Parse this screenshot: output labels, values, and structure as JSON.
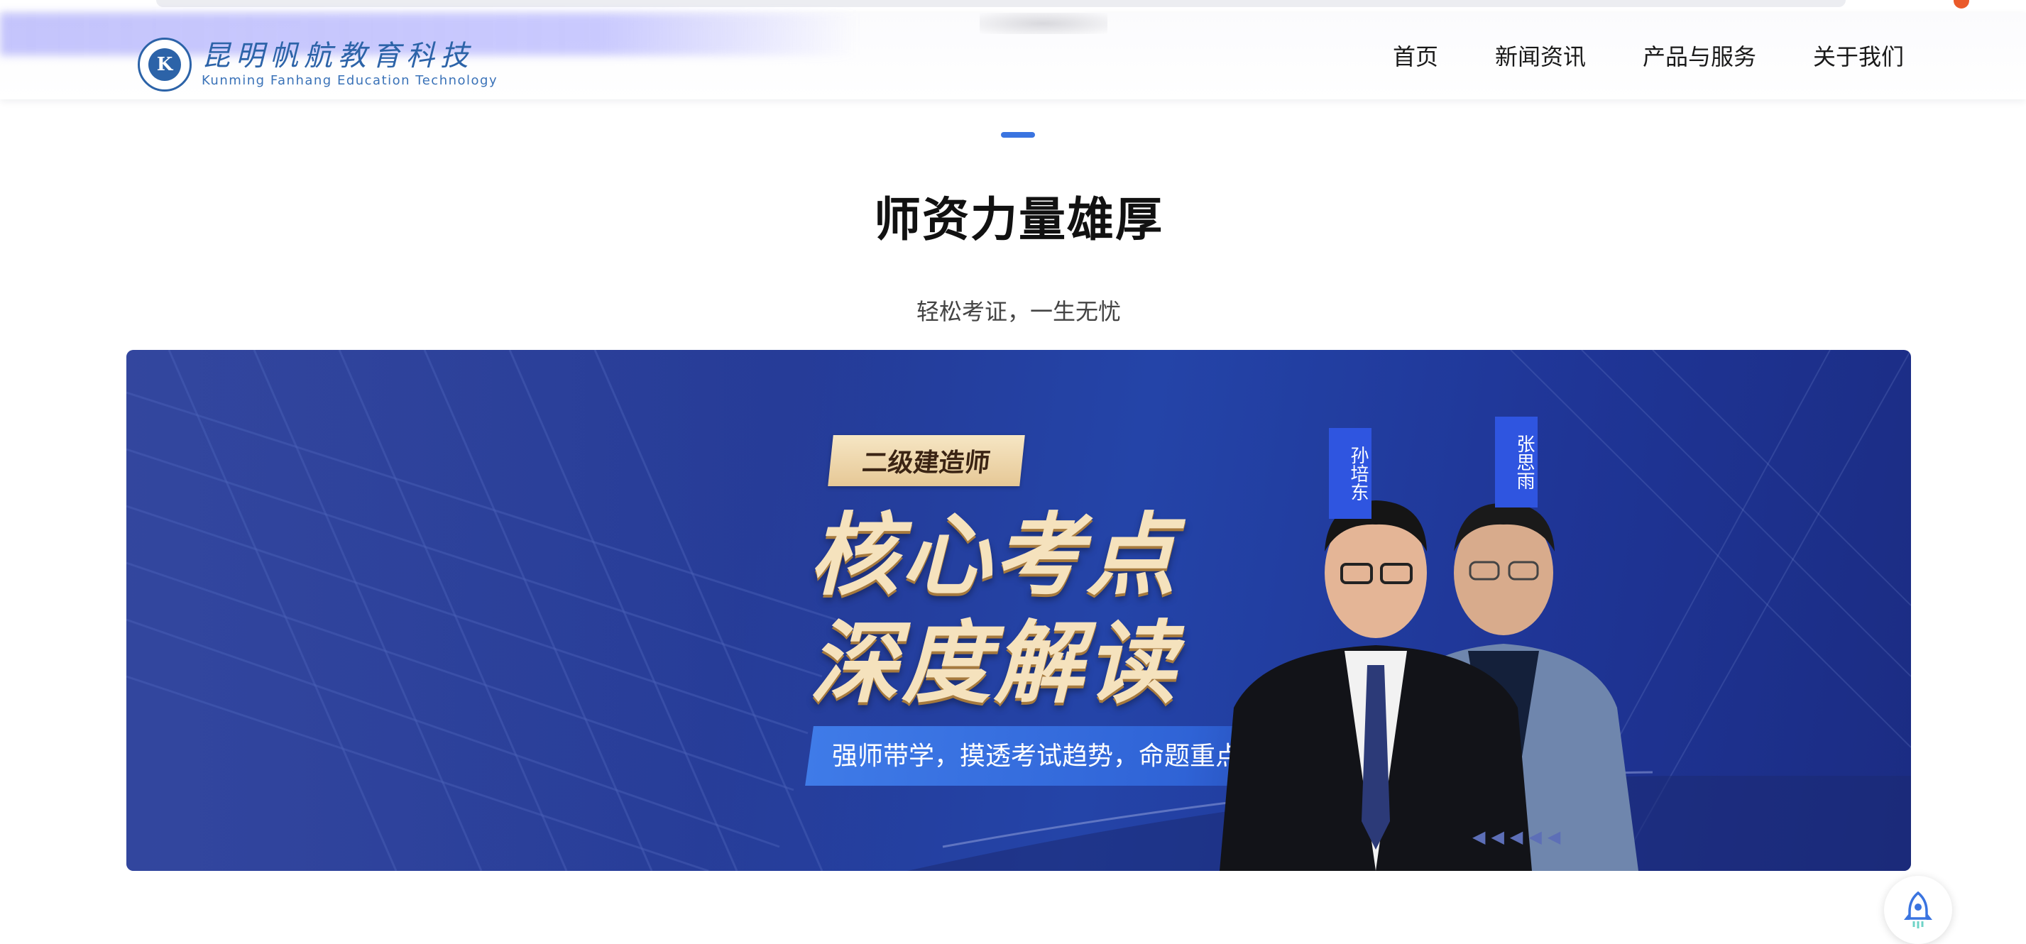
{
  "header": {
    "logo_cn": "昆明帆航教育科技",
    "logo_en": "Kunming Fanhang Education Technology",
    "nav": [
      {
        "label": "首页"
      },
      {
        "label": "新闻资讯"
      },
      {
        "label": "产品与服务"
      },
      {
        "label": "关于我们"
      }
    ]
  },
  "section": {
    "title": "师资力量雄厚",
    "subtitle": "轻松考证，一生无忧"
  },
  "banner": {
    "tag": "二级建造师",
    "headline_line1": "核心考点",
    "headline_line2": "深度解读",
    "slogan": "强师带学，摸透考试趋势，命题重点把握准",
    "teachers": [
      {
        "name": "孙培东"
      },
      {
        "name": "张思雨"
      }
    ]
  },
  "colors": {
    "accent": "#3a74e0",
    "banner_bg": "#243a96",
    "gold": "#f5e2bd",
    "logo_blue": "#2c63a8"
  },
  "icons": {
    "help": "rocket-icon"
  }
}
